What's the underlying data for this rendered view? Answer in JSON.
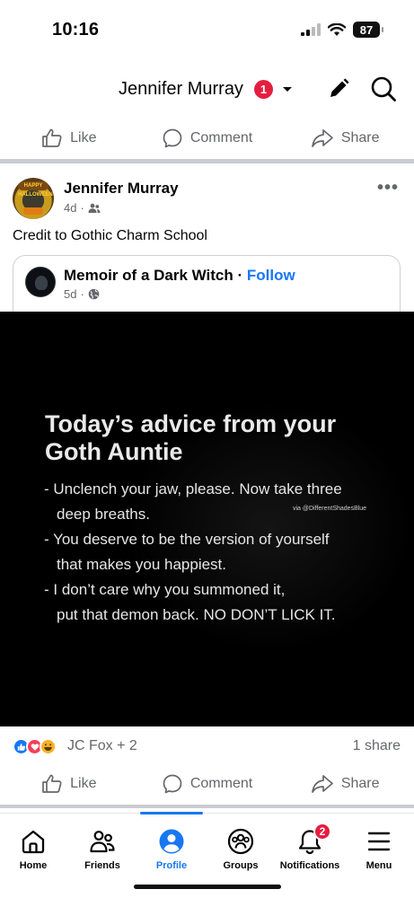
{
  "status_bar": {
    "time": "10:16",
    "battery": "87"
  },
  "profile_header": {
    "name": "Jennifer Murray",
    "badge_count": "1"
  },
  "actions": {
    "like": "Like",
    "comment": "Comment",
    "share": "Share"
  },
  "post": {
    "author": "Jennifer Murray",
    "time": "4d",
    "caption": "Credit to Gothic Charm School",
    "avatar_text": "HAPPY HALLOWEEN",
    "shared": {
      "page_name": "Memoir of a Dark Witch",
      "separator": " · ",
      "follow": "Follow",
      "time": "5d"
    },
    "image": {
      "title_line1": "Today’s advice from your",
      "title_line2": "Goth Auntie",
      "lines": [
        "- Unclench your jaw, please. Now take three",
        "deep breaths.",
        "- You deserve to be the version of yourself",
        "that makes you happiest.",
        "- I don’t care why you summoned it,",
        "put that demon back. NO DON’T LICK IT."
      ],
      "via": "via @DifferentShadesBlue"
    },
    "reactions": {
      "names": "JC Fox + 2",
      "shares": "1 share"
    }
  },
  "tabbar": {
    "home": "Home",
    "friends": "Friends",
    "profile": "Profile",
    "groups": "Groups",
    "notifications": "Notifications",
    "notifications_badge": "2",
    "menu": "Menu"
  },
  "colors": {
    "accent": "#1877f2",
    "badge": "#e41e3f",
    "muted": "#65676b"
  }
}
